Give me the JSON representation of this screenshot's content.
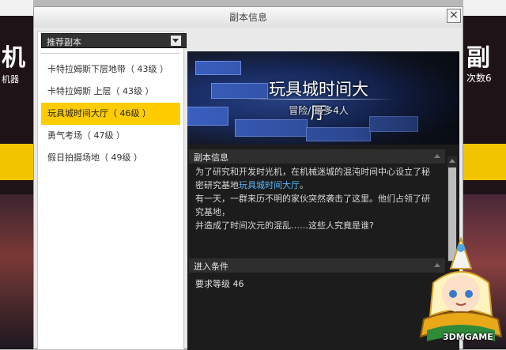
{
  "window": {
    "title": "副本信息",
    "close_label": "×"
  },
  "left_panel": {
    "dropdown_label": "推荐副本",
    "dungeons": [
      {
        "label": "卡特拉姆斯下层地带（ 43级 ）",
        "selected": false
      },
      {
        "label": "卡特拉姆斯 上层（ 43级 ）",
        "selected": false
      },
      {
        "label": "玩具城时间大厅（ 46级 ）",
        "selected": true
      },
      {
        "label": "勇气考场（ 47级 ）",
        "selected": false
      },
      {
        "label": "假日拍摄场地（ 49级 ）",
        "selected": false
      }
    ]
  },
  "detail": {
    "dungeon_name": "玩具城时间大厅",
    "subtitle": "冒险/ 最多4人",
    "info_header": "副本信息",
    "description": {
      "line1_a": "为了研究和开发时光机，在机械迷城的混沌时间中心设立了秘",
      "line2_a": "密研究基地",
      "line2_link": "玩具城时间大厅",
      "line2_b": "。",
      "line3": "有一天，一群来历不明的家伙突然袭击了这里。他们占领了研",
      "line4": "究基地，",
      "line5": "并造成了时间次元的混乱……这些人究竟是谁?"
    },
    "entry_header": "进入条件",
    "entry_requirement": "要求等级 46"
  },
  "background": {
    "left_big": "机",
    "left_small": "机器",
    "right_big": "副",
    "right_small": "次数6"
  },
  "watermark": "3DMGAME",
  "colors": {
    "selected": "#ffcc00",
    "highlight_link": "#55b8ff",
    "panel_dark": "#1c1c1c"
  }
}
